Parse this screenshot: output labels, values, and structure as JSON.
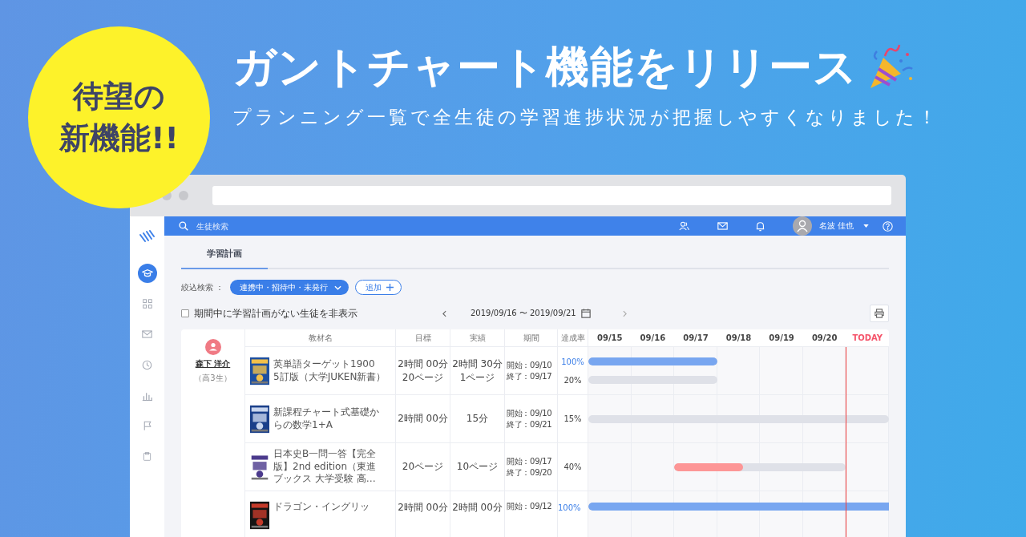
{
  "badge": {
    "lines": [
      "待望の",
      "新機能!!"
    ]
  },
  "headline": "ガントチャート機能をリリース",
  "subheadline": "プランニング一覧で全生徒の学習進捗状況が把握しやすくなりました！",
  "sidebar": {
    "items": [
      {
        "selected": true
      },
      {
        "selected": false
      },
      {
        "selected": false
      },
      {
        "selected": false
      },
      {
        "selected": false
      },
      {
        "selected": false
      },
      {
        "selected": false
      }
    ]
  },
  "header": {
    "search": {
      "placeholder": "生徒検索"
    },
    "user": {
      "name": "名波 佳也"
    }
  },
  "tabs": [
    {
      "label": "学習計画",
      "selected": true
    }
  ],
  "filter": {
    "label": "絞込検索 ：",
    "chip": "連携中・招待中・未発行",
    "add_button": "追加"
  },
  "hide_empty": {
    "label": "期間中に学習計画がない生徒を非表示",
    "checked": false
  },
  "date_range": "2019/09/16 〜 2019/09/21",
  "student": {
    "name": "森下 洋介",
    "grade": "（高3生）"
  },
  "table": {
    "columns": [
      "教材名",
      "目標",
      "実績",
      "期間",
      "達成率"
    ],
    "days": [
      {
        "label": "09/15",
        "kind": "date"
      },
      {
        "label": "09/16",
        "kind": "date"
      },
      {
        "label": "09/17",
        "kind": "date"
      },
      {
        "label": "09/18",
        "kind": "date"
      },
      {
        "label": "09/19",
        "kind": "date"
      },
      {
        "label": "09/20",
        "kind": "date"
      },
      {
        "label": "TODAY",
        "kind": "today"
      }
    ],
    "rows": [
      {
        "title": [
          "英単語ターゲット1900",
          "5訂版（大学JUKEN新書）"
        ],
        "goal": [
          "2時間 00分",
          "20ページ"
        ],
        "actual": [
          "2時間 30分",
          "1ページ"
        ],
        "period": {
          "start_label": "開始：",
          "start": "09/10",
          "end_label": "終了：",
          "end": "09/17"
        },
        "bars": [
          {
            "rate": "100%",
            "level": 1,
            "color": "#78a6f0"
          },
          {
            "rate": "20%"
          }
        ]
      },
      {
        "title": [
          "新課程チャート式基礎か",
          "らの数学1+A"
        ],
        "goal": [
          "2時間 00分"
        ],
        "actual": [
          "15分"
        ],
        "period": {
          "start_label": "開始：",
          "start": "09/10",
          "end_label": "終了：",
          "end": "09/21"
        },
        "bars": [
          {
            "rate": "15%"
          }
        ]
      },
      {
        "title": [
          "日本史B一問一答【完全",
          "版】2nd edition（東進",
          "ブックス 大学受験 高…"
        ],
        "goal": [
          "20ページ"
        ],
        "actual": [
          "10ページ"
        ],
        "period": {
          "start_label": "開始：",
          "start": "09/17",
          "end_label": "終了：",
          "end": "09/20"
        },
        "bars": [
          {
            "rate": "40%",
            "level": 0.4,
            "color": "#fd9696"
          }
        ]
      },
      {
        "title": [
          "ドラゴン・イングリッ"
        ],
        "goal": [
          "2時間 00分"
        ],
        "actual": [
          "2時間 00分"
        ],
        "period": {
          "start_label": "開始：",
          "start": "09/12"
        },
        "bars": [
          {
            "rate": "100%",
            "level": 1,
            "color": "#78a6f0"
          }
        ]
      }
    ]
  }
}
